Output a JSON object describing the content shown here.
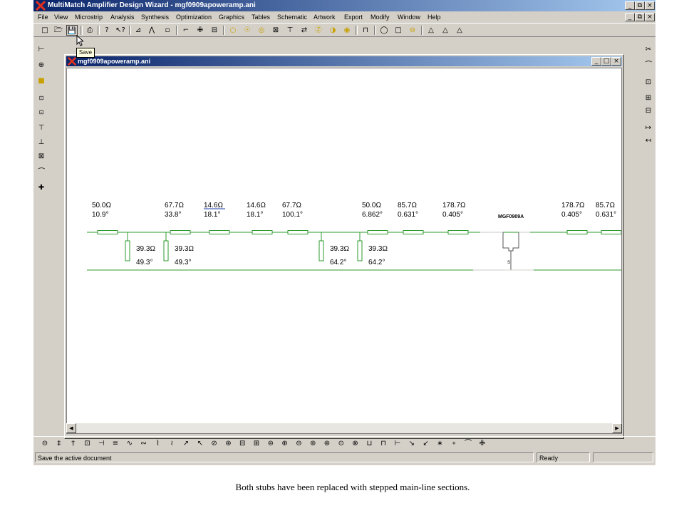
{
  "window": {
    "title": "MultiMatch Amplifier Design Wizard - mgf0909apoweramp.ani",
    "minimize": "_",
    "restore": "⧉",
    "close": "×"
  },
  "menu": [
    "File",
    "View",
    "Microstrip",
    "Analysis",
    "Synthesis",
    "Optimization",
    "Graphics",
    "Tables",
    "Schematic",
    "Artwork",
    "Export",
    "Modify",
    "Window",
    "Help"
  ],
  "tooltip": "Save",
  "document": {
    "title": "mgf0909apoweramp.ani",
    "minimize": "_",
    "restore": "□",
    "close": "×"
  },
  "schematic": {
    "elements": [
      {
        "kind": "series",
        "z": "50.0Ω",
        "angle": "10.9°",
        "underline": false
      },
      {
        "kind": "stub",
        "z": "39.3Ω",
        "angle": "49.3°"
      },
      {
        "kind": "stub",
        "z": "39.3Ω",
        "angle": "49.3°"
      },
      {
        "kind": "series",
        "z": "67.7Ω",
        "angle": "33.8°",
        "underline": false
      },
      {
        "kind": "series",
        "z": "14.6Ω",
        "angle": "18.1°",
        "underline": true
      },
      {
        "kind": "series",
        "z": "14.6Ω",
        "angle": "18.1°",
        "underline": false
      },
      {
        "kind": "series",
        "z": "67.7Ω",
        "angle": "100.1°",
        "underline": false
      },
      {
        "kind": "stub",
        "z": "39.3Ω",
        "angle": "64.2°"
      },
      {
        "kind": "stub",
        "z": "39.3Ω",
        "angle": "64.2°"
      },
      {
        "kind": "series",
        "z": "50.0Ω",
        "angle": "6.862°",
        "underline": false
      },
      {
        "kind": "series",
        "z": "85.7Ω",
        "angle": "0.631°",
        "underline": false
      },
      {
        "kind": "series",
        "z": "178.7Ω",
        "angle": "0.405°",
        "underline": false
      },
      {
        "kind": "series",
        "z": "178.7Ω",
        "angle": "0.405°",
        "underline": false
      },
      {
        "kind": "series",
        "z": "85.7Ω",
        "angle": "0.631°",
        "underline": false
      }
    ],
    "device": {
      "label": "MGF0909A",
      "pin": "S"
    }
  },
  "status": {
    "message": "Save the active document",
    "state": "Ready"
  },
  "caption": "Both stubs have been replaced with stepped main-line sections.",
  "colors": {
    "line": "#2e9a2e",
    "titlebar": "#0a246a",
    "chrome": "#d4d0c8",
    "underline": "#1a3aa8"
  },
  "icons": {
    "toolbar": [
      "new-icon",
      "open-icon",
      "save-icon",
      "print-icon",
      "help-icon",
      "context-help-icon",
      "tee-icon",
      "tee-alt-icon",
      "port-icon",
      "bend-icon",
      "cross-icon",
      "box-icon",
      "circle-icon",
      "circle-question-icon",
      "circle-dot-icon",
      "box-x-icon",
      "junction-icon",
      "swap-arrows-icon",
      "circle-y-icon",
      "circle-triangle-icon",
      "circle-point-icon",
      "pulse-icon",
      "ring-icon",
      "square-icon",
      "ring-minus-icon",
      "amp-1-icon",
      "amp-2-icon",
      "amp-3-icon"
    ],
    "left": [
      "port-left-icon",
      "port-plus-icon",
      "square-yellow-icon",
      "cir-icon",
      "cir-alt-icon",
      "stub-open-icon",
      "stub-short-icon",
      "box-stub-icon",
      "cap-icon",
      "cross-stub-icon"
    ],
    "right": [
      "scissors-icon",
      "cap-top-icon",
      "box-small-icon",
      "box-plus-icon",
      "box-minus-icon",
      "arrow-in-icon",
      "arrow-out-icon"
    ],
    "bottom": [
      "line-a-icon",
      "line-b-icon",
      "line-c-icon",
      "line-d-icon",
      "line-e-icon",
      "line-f-icon",
      "line-g-icon",
      "line-h-icon",
      "line-i-icon",
      "line-j-icon",
      "line-k-icon",
      "line-l-icon",
      "line-m-icon",
      "line-n-icon",
      "line-o-icon",
      "line-p-icon",
      "line-q-icon",
      "line-r-icon",
      "line-s-icon",
      "line-t-icon",
      "line-u-icon",
      "line-v-icon",
      "line-w-icon",
      "line-x-icon",
      "line-y-icon",
      "line-z-icon",
      "line-aa-icon",
      "line-ab-icon",
      "line-ac-icon",
      "line-ad-icon",
      "line-ae-icon",
      "line-af-icon"
    ]
  }
}
